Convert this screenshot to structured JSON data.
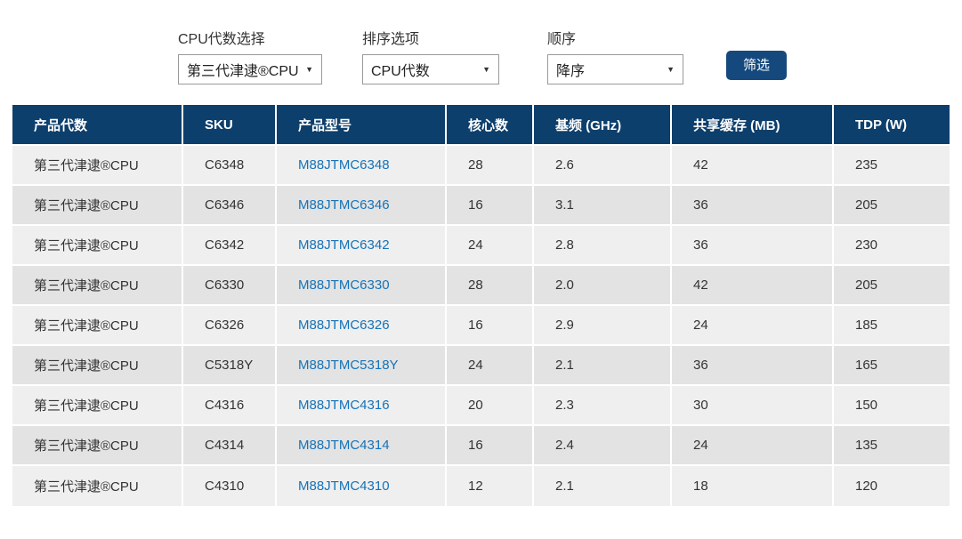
{
  "filters": {
    "generation": {
      "label": "CPU代数选择",
      "value": "第三代津逮®CPU"
    },
    "sort": {
      "label": "排序选项",
      "value": "CPU代数"
    },
    "order": {
      "label": "顺序",
      "value": "降序"
    },
    "submit_label": "筛选"
  },
  "table": {
    "columns": [
      "产品代数",
      "SKU",
      "产品型号",
      "核心数",
      "基频 (GHz)",
      "共享缓存 (MB)",
      "TDP (W)"
    ],
    "rows": [
      {
        "generation": "第三代津逮®CPU",
        "sku": "C6348",
        "model": "M88JTMC6348",
        "cores": "28",
        "base_freq_ghz": "2.6",
        "cache_mb": "42",
        "tdp_w": "235"
      },
      {
        "generation": "第三代津逮®CPU",
        "sku": "C6346",
        "model": "M88JTMC6346",
        "cores": "16",
        "base_freq_ghz": "3.1",
        "cache_mb": "36",
        "tdp_w": "205"
      },
      {
        "generation": "第三代津逮®CPU",
        "sku": "C6342",
        "model": "M88JTMC6342",
        "cores": "24",
        "base_freq_ghz": "2.8",
        "cache_mb": "36",
        "tdp_w": "230"
      },
      {
        "generation": "第三代津逮®CPU",
        "sku": "C6330",
        "model": "M88JTMC6330",
        "cores": "28",
        "base_freq_ghz": "2.0",
        "cache_mb": "42",
        "tdp_w": "205"
      },
      {
        "generation": "第三代津逮®CPU",
        "sku": "C6326",
        "model": "M88JTMC6326",
        "cores": "16",
        "base_freq_ghz": "2.9",
        "cache_mb": "24",
        "tdp_w": "185"
      },
      {
        "generation": "第三代津逮®CPU",
        "sku": "C5318Y",
        "model": "M88JTMC5318Y",
        "cores": "24",
        "base_freq_ghz": "2.1",
        "cache_mb": "36",
        "tdp_w": "165"
      },
      {
        "generation": "第三代津逮®CPU",
        "sku": "C4316",
        "model": "M88JTMC4316",
        "cores": "20",
        "base_freq_ghz": "2.3",
        "cache_mb": "30",
        "tdp_w": "150"
      },
      {
        "generation": "第三代津逮®CPU",
        "sku": "C4314",
        "model": "M88JTMC4314",
        "cores": "16",
        "base_freq_ghz": "2.4",
        "cache_mb": "24",
        "tdp_w": "135"
      },
      {
        "generation": "第三代津逮®CPU",
        "sku": "C4310",
        "model": "M88JTMC4310",
        "cores": "12",
        "base_freq_ghz": "2.1",
        "cache_mb": "18",
        "tdp_w": "120"
      }
    ]
  },
  "icons": {
    "select_arrow": "▼"
  },
  "colors": {
    "header_bg": "#0d3f6c",
    "button_bg": "#15497d",
    "link": "#1472b8",
    "row_odd_bg": "#efefef",
    "row_even_bg": "#e3e3e3",
    "text": "#333333"
  }
}
